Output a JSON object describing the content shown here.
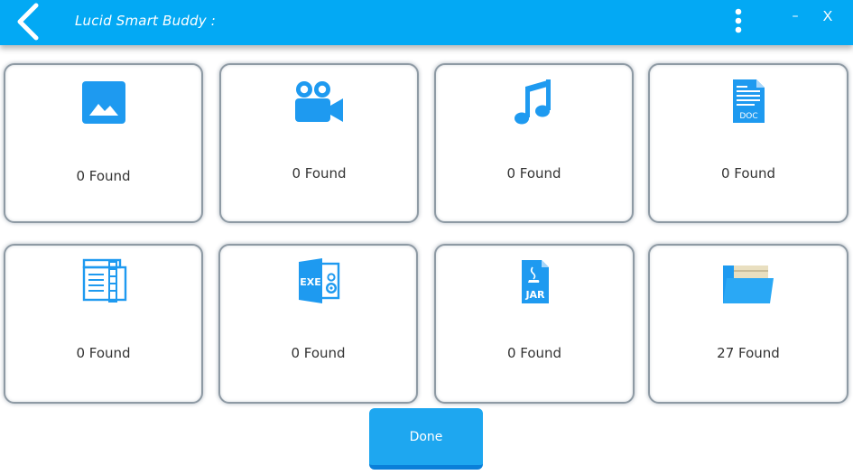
{
  "app": {
    "title": "Lucid Smart Buddy :",
    "minimize_label": "–",
    "close_label": "X"
  },
  "colors": {
    "titlebar": "#03a9f4",
    "icon_blue": "#1e9af0",
    "button": "#1ea7f0"
  },
  "categories": [
    {
      "icon": "image-icon",
      "count_text": "0 Found"
    },
    {
      "icon": "video-camera-icon",
      "count_text": "0 Found"
    },
    {
      "icon": "music-note-icon",
      "count_text": "0 Found"
    },
    {
      "icon": "doc-file-icon",
      "count_text": "0 Found"
    },
    {
      "icon": "zip-archive-icon",
      "count_text": "0 Found"
    },
    {
      "icon": "exe-file-icon",
      "count_text": "0 Found"
    },
    {
      "icon": "jar-file-icon",
      "count_text": "0 Found"
    },
    {
      "icon": "folder-icon",
      "count_text": "27 Found"
    }
  ],
  "done_label": "Done"
}
